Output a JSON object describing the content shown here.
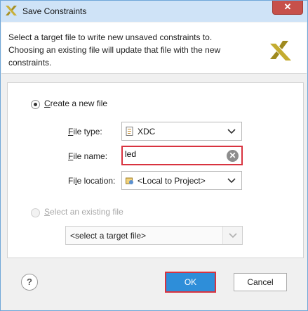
{
  "window": {
    "title": "Save Constraints",
    "close_glyph": "✕"
  },
  "header": {
    "description": "Select a target file to write new unsaved constraints to. Choosing an existing file will update that file with the new constraints."
  },
  "create_new": {
    "label_mnemonic": "C",
    "label_rest": "reate a new file",
    "selected": true,
    "file_type": {
      "label_mnemonic": "F",
      "label_rest": "ile type:",
      "value": "XDC"
    },
    "file_name": {
      "label_mnemonic": "F",
      "label_rest": "ile name:",
      "value": "led"
    },
    "file_location": {
      "label_pre": "Fi",
      "label_mnemonic": "l",
      "label_rest": "e location:",
      "value": "<Local to Project>"
    }
  },
  "select_existing": {
    "label_mnemonic": "S",
    "label_rest": "elect an existing file",
    "selected": false,
    "target_placeholder": "<select a target file>"
  },
  "buttons": {
    "help": "?",
    "ok": "OK",
    "cancel": "Cancel"
  },
  "colors": {
    "accent": "#2e8ed9",
    "highlight": "#d8333f",
    "titlebar": "#cfe3f7"
  }
}
